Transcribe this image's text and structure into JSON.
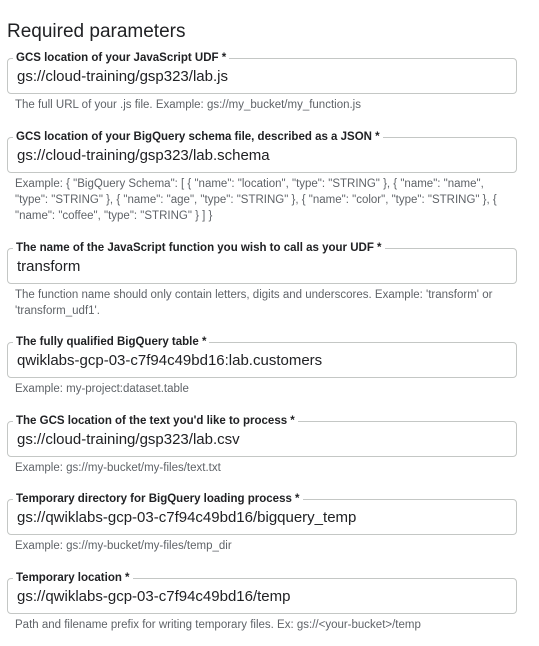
{
  "section": {
    "title": "Required parameters"
  },
  "fields": [
    {
      "label": "GCS location of your JavaScript UDF *",
      "value": "gs://cloud-training/gsp323/lab.js",
      "helper": "The full URL of your .js file. Example: gs://my_bucket/my_function.js"
    },
    {
      "label": "GCS location of your BigQuery schema file, described as a JSON *",
      "value": "gs://cloud-training/gsp323/lab.schema",
      "helper": "Example: { \"BigQuery Schema\": [ { \"name\": \"location\", \"type\": \"STRING\" }, { \"name\": \"name\", \"type\": \"STRING\" }, { \"name\": \"age\", \"type\": \"STRING\" }, { \"name\": \"color\", \"type\": \"STRING\" }, { \"name\": \"coffee\", \"type\": \"STRING\" } ] }"
    },
    {
      "label": "The name of the JavaScript function you wish to call as your UDF *",
      "value": "transform",
      "helper": "The function name should only contain letters, digits and underscores. Example: 'transform' or 'transform_udf1'."
    },
    {
      "label": "The fully qualified BigQuery table *",
      "value": "qwiklabs-gcp-03-c7f94c49bd16:lab.customers",
      "helper": "Example: my-project:dataset.table"
    },
    {
      "label": "The GCS location of the text you'd like to process *",
      "value": "gs://cloud-training/gsp323/lab.csv",
      "helper": "Example: gs://my-bucket/my-files/text.txt"
    },
    {
      "label": "Temporary directory for BigQuery loading process *",
      "value": "gs://qwiklabs-gcp-03-c7f94c49bd16/bigquery_temp",
      "helper": "Example: gs://my-bucket/my-files/temp_dir"
    },
    {
      "label": "Temporary location *",
      "value": "gs://qwiklabs-gcp-03-c7f94c49bd16/temp",
      "helper": "Path and filename prefix for writing temporary files. Ex: gs://<your-bucket>/temp"
    }
  ]
}
